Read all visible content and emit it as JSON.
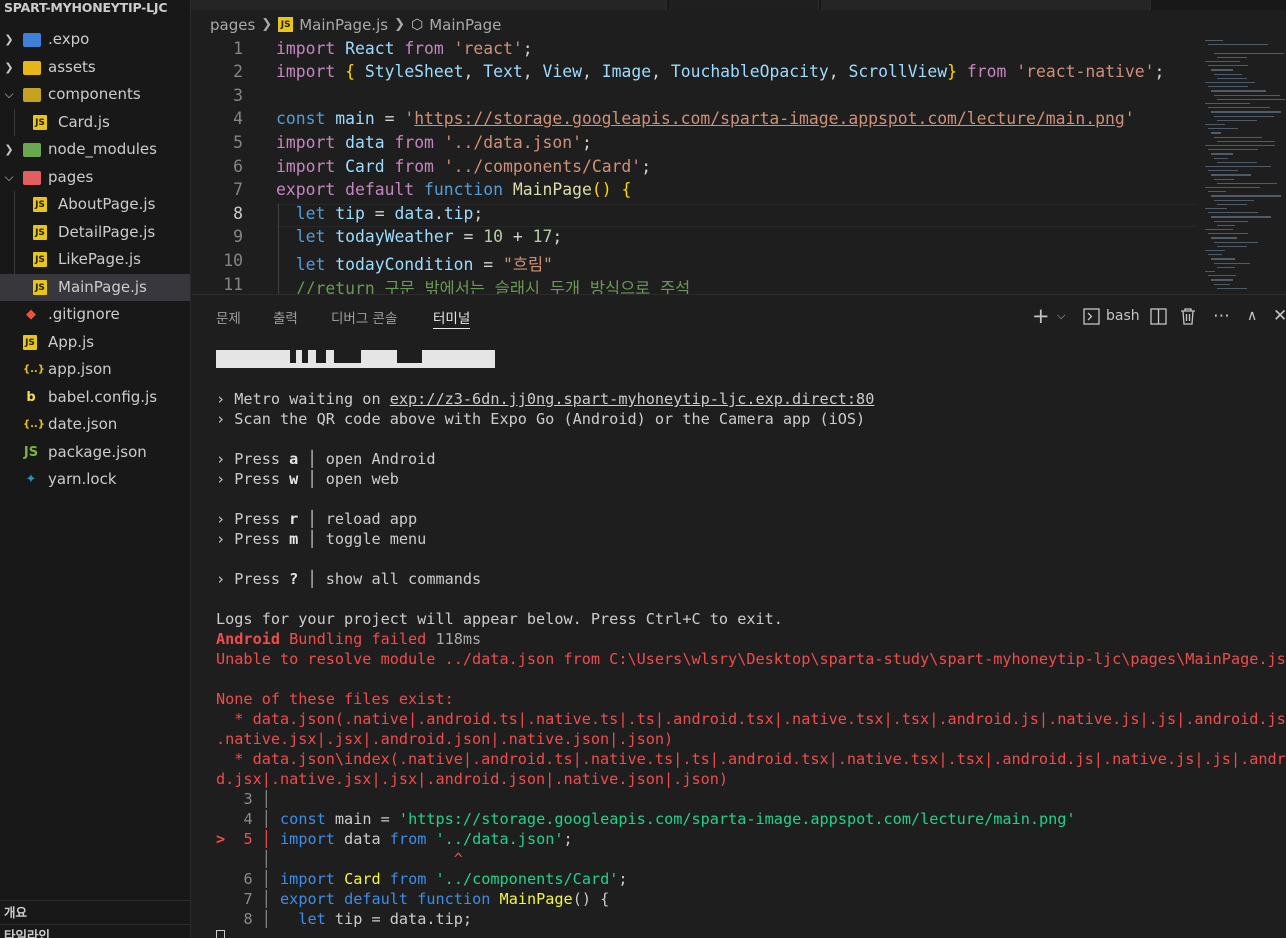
{
  "explorer": {
    "root_title": "SPART-MYHONEYTIP-LJC",
    "items": [
      {
        "label": ".expo",
        "kind": "folder",
        "open": false,
        "depth": 0,
        "icon": "expo-folder-icon"
      },
      {
        "label": "assets",
        "kind": "folder",
        "open": false,
        "depth": 0,
        "icon": "assets-folder-icon"
      },
      {
        "label": "components",
        "kind": "folder",
        "open": true,
        "depth": 0,
        "icon": "components-folder-icon"
      },
      {
        "label": "Card.js",
        "kind": "js",
        "depth": 1
      },
      {
        "label": "node_modules",
        "kind": "folder",
        "open": false,
        "depth": 0,
        "icon": "node-folder-icon"
      },
      {
        "label": "pages",
        "kind": "folder",
        "open": true,
        "depth": 0,
        "icon": "pages-folder-icon"
      },
      {
        "label": "AboutPage.js",
        "kind": "js",
        "depth": 1
      },
      {
        "label": "DetailPage.js",
        "kind": "js",
        "depth": 1
      },
      {
        "label": "LikePage.js",
        "kind": "js",
        "depth": 1
      },
      {
        "label": "MainPage.js",
        "kind": "js",
        "depth": 1,
        "selected": true
      },
      {
        "label": ".gitignore",
        "kind": "git",
        "depth": 0
      },
      {
        "label": "App.js",
        "kind": "js",
        "depth": 0
      },
      {
        "label": "app.json",
        "kind": "json",
        "depth": 0
      },
      {
        "label": "babel.config.js",
        "kind": "babel",
        "depth": 0
      },
      {
        "label": "date.json",
        "kind": "json",
        "depth": 0
      },
      {
        "label": "package.json",
        "kind": "node",
        "depth": 0
      },
      {
        "label": "yarn.lock",
        "kind": "yarn",
        "depth": 0
      }
    ],
    "outline_label": "개요",
    "timeline_label": "타임라인"
  },
  "breadcrumb": {
    "folder": "pages",
    "file": "MainPage.js",
    "symbol": "MainPage",
    "file_badge": "JS"
  },
  "editor": {
    "current_line": 8,
    "lines": [
      {
        "n": "1",
        "tokens": [
          [
            "imp",
            "import"
          ],
          [
            "",
            " "
          ],
          [
            "var",
            "React"
          ],
          [
            "",
            " "
          ],
          [
            "imp",
            "from"
          ],
          [
            "",
            " "
          ],
          [
            "str",
            "'react'"
          ],
          [
            "",
            ";"
          ]
        ]
      },
      {
        "n": "2",
        "tokens": [
          [
            "imp",
            "import"
          ],
          [
            "",
            " "
          ],
          [
            "br",
            "{"
          ],
          [
            "",
            " "
          ],
          [
            "var",
            "StyleSheet"
          ],
          [
            "",
            ", "
          ],
          [
            "var",
            "Text"
          ],
          [
            "",
            ", "
          ],
          [
            "var",
            "View"
          ],
          [
            "",
            ", "
          ],
          [
            "var",
            "Image"
          ],
          [
            "",
            ", "
          ],
          [
            "var",
            "TouchableOpacity"
          ],
          [
            "",
            ", "
          ],
          [
            "var",
            "ScrollView"
          ],
          [
            "br",
            "}"
          ],
          [
            "",
            " "
          ],
          [
            "imp",
            "from"
          ],
          [
            "",
            " "
          ],
          [
            "str",
            "'react-native'"
          ],
          [
            "",
            ";"
          ]
        ]
      },
      {
        "n": "3",
        "tokens": []
      },
      {
        "n": "4",
        "tokens": [
          [
            "kw",
            "const"
          ],
          [
            "",
            " "
          ],
          [
            "var",
            "main"
          ],
          [
            "",
            ""
          ],
          [
            "",
            " = "
          ],
          [
            "str",
            "'"
          ],
          [
            "url",
            "https://storage.googleapis.com/sparta-image.appspot.com/lecture/main.png"
          ],
          [
            "str",
            "'"
          ]
        ]
      },
      {
        "n": "5",
        "tokens": [
          [
            "imp",
            "import"
          ],
          [
            "",
            " "
          ],
          [
            "var",
            "data"
          ],
          [
            "",
            " "
          ],
          [
            "imp",
            "from"
          ],
          [
            "",
            " "
          ],
          [
            "str",
            "'../data.json'"
          ],
          [
            "",
            ";"
          ]
        ]
      },
      {
        "n": "6",
        "tokens": [
          [
            "imp",
            "import"
          ],
          [
            "",
            " "
          ],
          [
            "var",
            "Card"
          ],
          [
            "",
            " "
          ],
          [
            "imp",
            "from"
          ],
          [
            "",
            " "
          ],
          [
            "str",
            "'../components/Card'"
          ],
          [
            "",
            ";"
          ]
        ]
      },
      {
        "n": "7",
        "tokens": [
          [
            "imp",
            "export"
          ],
          [
            "",
            " "
          ],
          [
            "imp",
            "default"
          ],
          [
            "",
            " "
          ],
          [
            "kw",
            "function"
          ],
          [
            "",
            " "
          ],
          [
            "fn",
            "MainPage"
          ],
          [
            "br",
            "()"
          ],
          [
            "",
            " "
          ],
          [
            "br",
            "{"
          ]
        ]
      },
      {
        "n": "8",
        "tokens": [
          [
            "",
            "  "
          ],
          [
            "kw",
            "let"
          ],
          [
            "",
            " "
          ],
          [
            "var",
            "tip"
          ],
          [
            "",
            " = "
          ],
          [
            "var",
            "data"
          ],
          [
            "",
            "."
          ],
          [
            "var",
            "tip"
          ],
          [
            "",
            ";"
          ]
        ]
      },
      {
        "n": "9",
        "tokens": [
          [
            "",
            "  "
          ],
          [
            "kw",
            "let"
          ],
          [
            "",
            " "
          ],
          [
            "var",
            "todayWeather"
          ],
          [
            "",
            " = "
          ],
          [
            "num",
            "10"
          ],
          [
            "",
            " + "
          ],
          [
            "num",
            "17"
          ],
          [
            "",
            ";"
          ]
        ]
      },
      {
        "n": "10",
        "tokens": [
          [
            "",
            "  "
          ],
          [
            "kw",
            "let"
          ],
          [
            "",
            " "
          ],
          [
            "var",
            "todayCondition"
          ],
          [
            "",
            " = "
          ],
          [
            "str",
            "\"흐림\""
          ]
        ]
      },
      {
        "n": "11",
        "tokens": [
          [
            "",
            "  "
          ],
          [
            "cm",
            "//return 구문 밖에서는 슬래시 두개 방식으로 주석"
          ]
        ]
      }
    ]
  },
  "panel": {
    "tabs": [
      "문제",
      "출력",
      "디버그 콘솔",
      "터미널"
    ],
    "active_tab": "터미널",
    "shell_label": "bash",
    "icons": [
      "plus-icon",
      "chevron-down-icon",
      "terminal-icon",
      "split-icon",
      "trash-icon",
      "ellipsis-icon",
      "chevron-up-icon",
      "close-icon"
    ]
  },
  "terminal": {
    "metro_prefix": "› Metro waiting on ",
    "metro_url": "exp://z3-6dn.jj0ng.spart-myhoneytip-ljc.exp.direct:80",
    "scan_line": "› Scan the QR code above with Expo Go (Android) or the Camera app (iOS)",
    "shortcuts": [
      {
        "key": "a",
        "label": "open Android"
      },
      {
        "key": "w",
        "label": "open web"
      },
      {
        "key": "r",
        "label": "reload app"
      },
      {
        "key": "m",
        "label": "toggle menu"
      },
      {
        "key": "?",
        "label": "show all commands"
      }
    ],
    "press_word": "› Press ",
    "logs_line": "Logs for your project will appear below. Press Ctrl+C to exit.",
    "bundling_platform": "Android",
    "bundling_text": " Bundling failed ",
    "bundling_time": "118ms",
    "unable_line": "Unable to resolve module ../data.json from C:\\Users\\wlsry\\Desktop\\sparta-study\\spart-myhoneytip-ljc\\pages\\MainPage.js:",
    "none_line": "None of these files exist:",
    "files_1a": "  * data.json(.native|.android.ts|.native.ts|.ts|.android.tsx|.native.tsx|.tsx|.android.js|.native.js|.js|.android.jsx|",
    "files_1b": ".native.jsx|.jsx|.android.json|.native.json|.json)",
    "files_2a": "  * data.json\\index(.native|.android.ts|.native.ts|.ts|.android.tsx|.native.tsx|.tsx|.android.js|.native.js|.js|.androi",
    "files_2b": "d.jsx|.native.jsx|.jsx|.android.json|.native.json|.json)",
    "snippet": [
      {
        "n": "3",
        "mark": "",
        "tokens": []
      },
      {
        "n": "4",
        "mark": "",
        "tokens": [
          [
            "blue",
            "const"
          ],
          [
            "",
            " "
          ],
          [
            "",
            "main"
          ],
          [
            "",
            " = "
          ],
          [
            "green",
            "'https://storage.googleapis.com/sparta-image.appspot.com/lecture/main.png'"
          ]
        ]
      },
      {
        "n": "5",
        "mark": ">",
        "tokens": [
          [
            "blue",
            "import"
          ],
          [
            "",
            " data "
          ],
          [
            "blue",
            "from"
          ],
          [
            "",
            " "
          ],
          [
            "green",
            "'../data.json'"
          ],
          [
            "",
            ";"
          ]
        ]
      },
      {
        "n": "",
        "mark": "",
        "tokens": [
          [
            "",
            "                   "
          ],
          [
            "red",
            "^"
          ]
        ]
      },
      {
        "n": "6",
        "mark": "",
        "tokens": [
          [
            "blue",
            "import"
          ],
          [
            "",
            " "
          ],
          [
            "yel",
            "Card"
          ],
          [
            "",
            " "
          ],
          [
            "blue",
            "from"
          ],
          [
            "",
            " "
          ],
          [
            "green",
            "'../components/Card'"
          ],
          [
            "",
            ";"
          ]
        ]
      },
      {
        "n": "7",
        "mark": "",
        "tokens": [
          [
            "blue",
            "export"
          ],
          [
            "",
            " "
          ],
          [
            "blue",
            "default"
          ],
          [
            "",
            " "
          ],
          [
            "blue",
            "function"
          ],
          [
            "",
            " "
          ],
          [
            "yel",
            "MainPage"
          ],
          [
            "",
            "() {"
          ]
        ]
      },
      {
        "n": "8",
        "mark": "",
        "tokens": [
          [
            "",
            "  "
          ],
          [
            "blue",
            "let"
          ],
          [
            "",
            " tip = data.tip;"
          ]
        ]
      }
    ]
  },
  "colors": {
    "sidebar_bg": "#181818",
    "editor_bg": "#1e1e1e",
    "selected_row": "#37373d",
    "js_badge": "#e8c518",
    "error_red": "#f14c4c",
    "keyword_blue": "#569cd6",
    "string_orange": "#ce9178"
  }
}
